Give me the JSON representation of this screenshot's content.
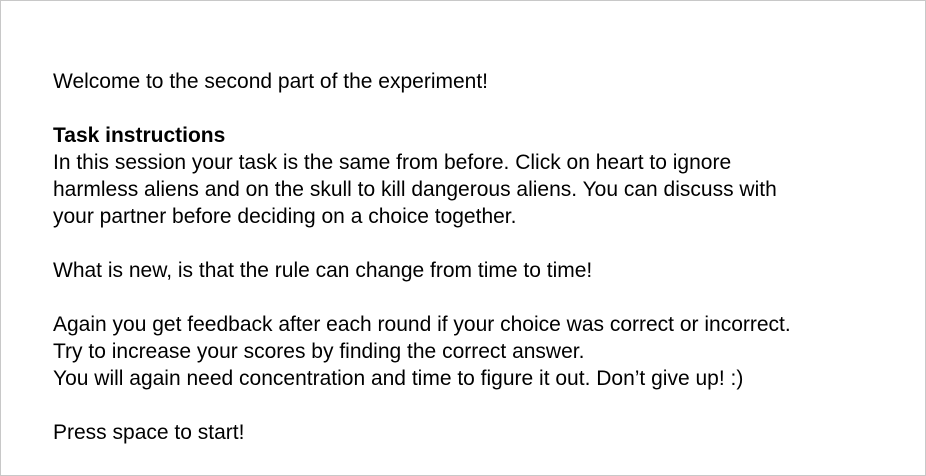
{
  "welcome": "Welcome to the second part of the experiment!",
  "instructions": {
    "heading": "Task instructions",
    "lines": [
      "In this session your task is the same from before. Click on heart to ignore",
      "harmless aliens and on the skull to kill dangerous aliens. You can discuss with",
      "your partner before deciding on a choice together."
    ]
  },
  "rule_change": "What is new, is that the rule can change from time to time!",
  "feedback": {
    "lines": [
      "Again you get feedback after each round if your choice was correct or incorrect.",
      "Try to increase your scores by finding the correct answer.",
      "You will again need concentration and time to figure it out. Don’t give up! :)"
    ]
  },
  "start_prompt": "Press space to start!"
}
